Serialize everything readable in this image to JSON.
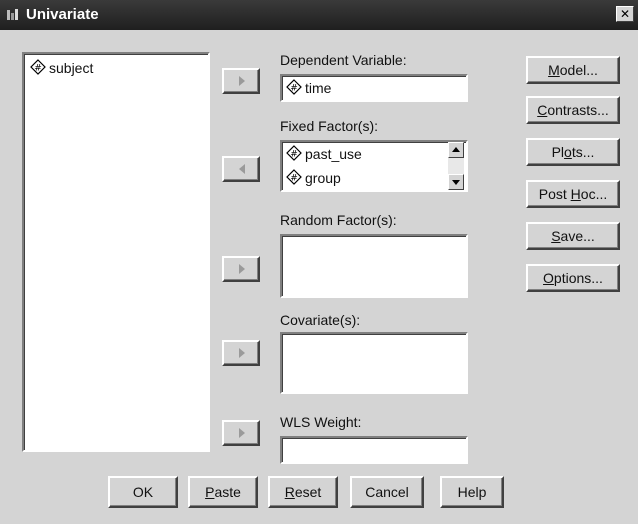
{
  "window": {
    "title": "Univariate",
    "close_glyph": "✕"
  },
  "source_list": {
    "items": [
      {
        "label": "subject",
        "icon": "scale-variable-icon"
      }
    ]
  },
  "dependent": {
    "label": "Dependent Variable:",
    "value": "time"
  },
  "fixed": {
    "label": "Fixed Factor(s):",
    "items": [
      "past_use",
      "group"
    ]
  },
  "random": {
    "label": "Random Factor(s):"
  },
  "covariate": {
    "label": "Covariate(s):"
  },
  "wls": {
    "label": "WLS Weight:"
  },
  "side_buttons": [
    {
      "pre": "",
      "u": "M",
      "post": "odel..."
    },
    {
      "pre": "",
      "u": "C",
      "post": "ontrasts..."
    },
    {
      "pre": "Pl",
      "u": "o",
      "post": "ts..."
    },
    {
      "pre": "Post ",
      "u": "H",
      "post": "oc..."
    },
    {
      "pre": "",
      "u": "S",
      "post": "ave..."
    },
    {
      "pre": "",
      "u": "O",
      "post": "ptions..."
    }
  ],
  "bottom_buttons": [
    {
      "pre": "",
      "u": "",
      "post": "OK"
    },
    {
      "pre": "",
      "u": "P",
      "post": "aste"
    },
    {
      "pre": "",
      "u": "R",
      "post": "eset"
    },
    {
      "pre": "",
      "u": "",
      "post": "Cancel"
    },
    {
      "pre": "",
      "u": "",
      "post": "Help"
    }
  ],
  "colors": {
    "dialog_bg": "#d4d4d4",
    "title_bg": "#1f1f1f",
    "field_bg": "#ffffff"
  }
}
